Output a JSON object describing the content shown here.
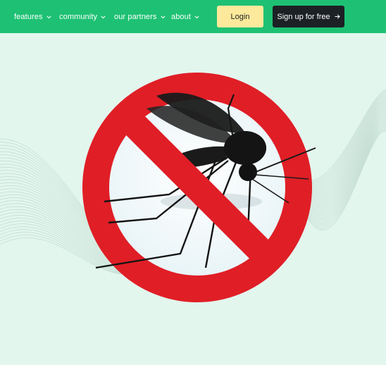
{
  "nav": {
    "items": [
      {
        "label": "features"
      },
      {
        "label": "community"
      },
      {
        "label": "our partners"
      },
      {
        "label": "about"
      }
    ]
  },
  "auth": {
    "login_label": "Login",
    "signup_label": "Sign up for free"
  },
  "colors": {
    "header_bg": "#1ec173",
    "page_bg": "#e3f6ee",
    "login_bg": "#fde99b",
    "signup_bg": "#1c2125",
    "prohibition_red": "#e01e26"
  },
  "hero": {
    "icon": "no-mosquito-icon"
  }
}
